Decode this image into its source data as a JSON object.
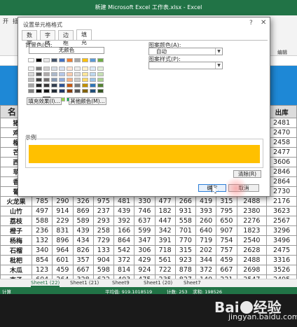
{
  "window": {
    "title": "新建 Microsoft Excel 工作表.xlsx - Excel"
  },
  "ribbon": {
    "tabs": [
      "开",
      "插"
    ],
    "right_label": "编辑"
  },
  "colors": {
    "excel_green": "#217346",
    "blue_band": "#1e88d6",
    "sample_fill": "#ffc000",
    "accent_button": "#2a7dd6"
  },
  "sheet": {
    "header_first": "名",
    "header_last": "出库",
    "col_c_last": [
      "2481",
      "2470",
      "2458",
      "2477",
      "3606",
      "2846",
      "2864",
      "2730"
    ],
    "first_col_partial": [
      "猪",
      "鸡",
      "榴",
      "芒",
      "西",
      "苹",
      "香",
      "葡"
    ],
    "rows": [
      [
        "火龙果",
        "785",
        "290",
        "326",
        "975",
        "481",
        "330",
        "477",
        "266",
        "419",
        "315",
        "2488",
        "2176"
      ],
      [
        "山竹",
        "497",
        "914",
        "869",
        "237",
        "439",
        "746",
        "182",
        "931",
        "393",
        "795",
        "2380",
        "3623"
      ],
      [
        "荔枝",
        "588",
        "229",
        "589",
        "293",
        "392",
        "637",
        "447",
        "558",
        "260",
        "650",
        "2276",
        "2567"
      ],
      [
        "橙子",
        "236",
        "831",
        "439",
        "258",
        "166",
        "599",
        "342",
        "701",
        "640",
        "907",
        "1823",
        "3296"
      ],
      [
        "杨梅",
        "132",
        "896",
        "434",
        "729",
        "864",
        "347",
        "391",
        "770",
        "719",
        "754",
        "2540",
        "3496"
      ],
      [
        "石榴",
        "340",
        "964",
        "826",
        "133",
        "542",
        "306",
        "718",
        "315",
        "202",
        "757",
        "2628",
        "2475"
      ],
      [
        "枇杷",
        "854",
        "601",
        "357",
        "904",
        "372",
        "429",
        "561",
        "923",
        "344",
        "459",
        "2488",
        "3316"
      ],
      [
        "木瓜",
        "123",
        "459",
        "667",
        "598",
        "814",
        "924",
        "722",
        "878",
        "372",
        "667",
        "2698",
        "3526"
      ],
      [
        "李子",
        "604",
        "264",
        "328",
        "622",
        "403",
        "475",
        "235",
        "827",
        "140",
        "221",
        "2547",
        "2495"
      ],
      [
        "菠萝蜜",
        "982",
        "749",
        "761",
        "306",
        "630",
        "806",
        "636",
        "363",
        "382",
        "854",
        "3391",
        "3078"
      ]
    ]
  },
  "sheet_tabs": [
    "Sheet1 (22)",
    "Sheet1 (21)",
    "Sheet9",
    "Sheet1 (20)",
    "Sheet7"
  ],
  "status": {
    "left": "计算",
    "average": "平均值: 919.1018519",
    "count": "计数: 253",
    "sum": "求和: 198526"
  },
  "dialog": {
    "title": "设置单元格格式",
    "help": "?",
    "close": "✕",
    "tabs": [
      "数字",
      "字体",
      "边框",
      "填充"
    ],
    "active_tab": "填充",
    "background_label": "背景色(C):",
    "no_color": "无颜色",
    "pattern_color_label": "图案颜色(A):",
    "pattern_color_value": "自动",
    "pattern_style_label": "图案样式(P):",
    "fill_effects": "填充效果(I)...",
    "more_colors": "其他颜色(M)...",
    "sample_label": "示例",
    "clear": "清除(R)",
    "ok": "确定",
    "cancel": "取消",
    "swatch_rows": [
      [
        "#ffffff",
        "#000000",
        "#e7e6e6",
        "#44546a",
        "#4472c4",
        "#ed7d31",
        "#a5a5a5",
        "#ffc000",
        "#5b9bd5",
        "#70ad47"
      ],
      [
        "#f2f2f2",
        "#7f7f7f",
        "#d0cece",
        "#d6dce4",
        "#d9e1f2",
        "#fce4d6",
        "#ededed",
        "#fff2cc",
        "#ddebf7",
        "#e2efda"
      ],
      [
        "#d9d9d9",
        "#595959",
        "#aeaaaa",
        "#acb9ca",
        "#b4c6e7",
        "#f8cbad",
        "#dbdbdb",
        "#ffe699",
        "#bdd7ee",
        "#c6e0b4"
      ],
      [
        "#bfbfbf",
        "#404040",
        "#757171",
        "#8497b0",
        "#8ea9db",
        "#f4b084",
        "#c9c9c9",
        "#ffd966",
        "#9bc2e6",
        "#a9d08e"
      ],
      [
        "#a6a6a6",
        "#262626",
        "#3a3838",
        "#333f4f",
        "#2f5496",
        "#c65911",
        "#7b7b7b",
        "#bf8f00",
        "#2e75b6",
        "#548235"
      ],
      [
        "#808080",
        "#0d0d0d",
        "#161616",
        "#222b35",
        "#203764",
        "#833c0c",
        "#525252",
        "#806000",
        "#1f4e78",
        "#375623"
      ],
      [
        "#c00000",
        "#ff0000",
        "#ffc000",
        "#ffff00",
        "#92d050",
        "#00b050",
        "#00b0f0",
        "#0070c0",
        "#002060",
        "#7030a0"
      ]
    ]
  },
  "watermark": {
    "logo_left": "Bai",
    "logo_right": "经验",
    "site": "jingyan.baidu.com"
  }
}
